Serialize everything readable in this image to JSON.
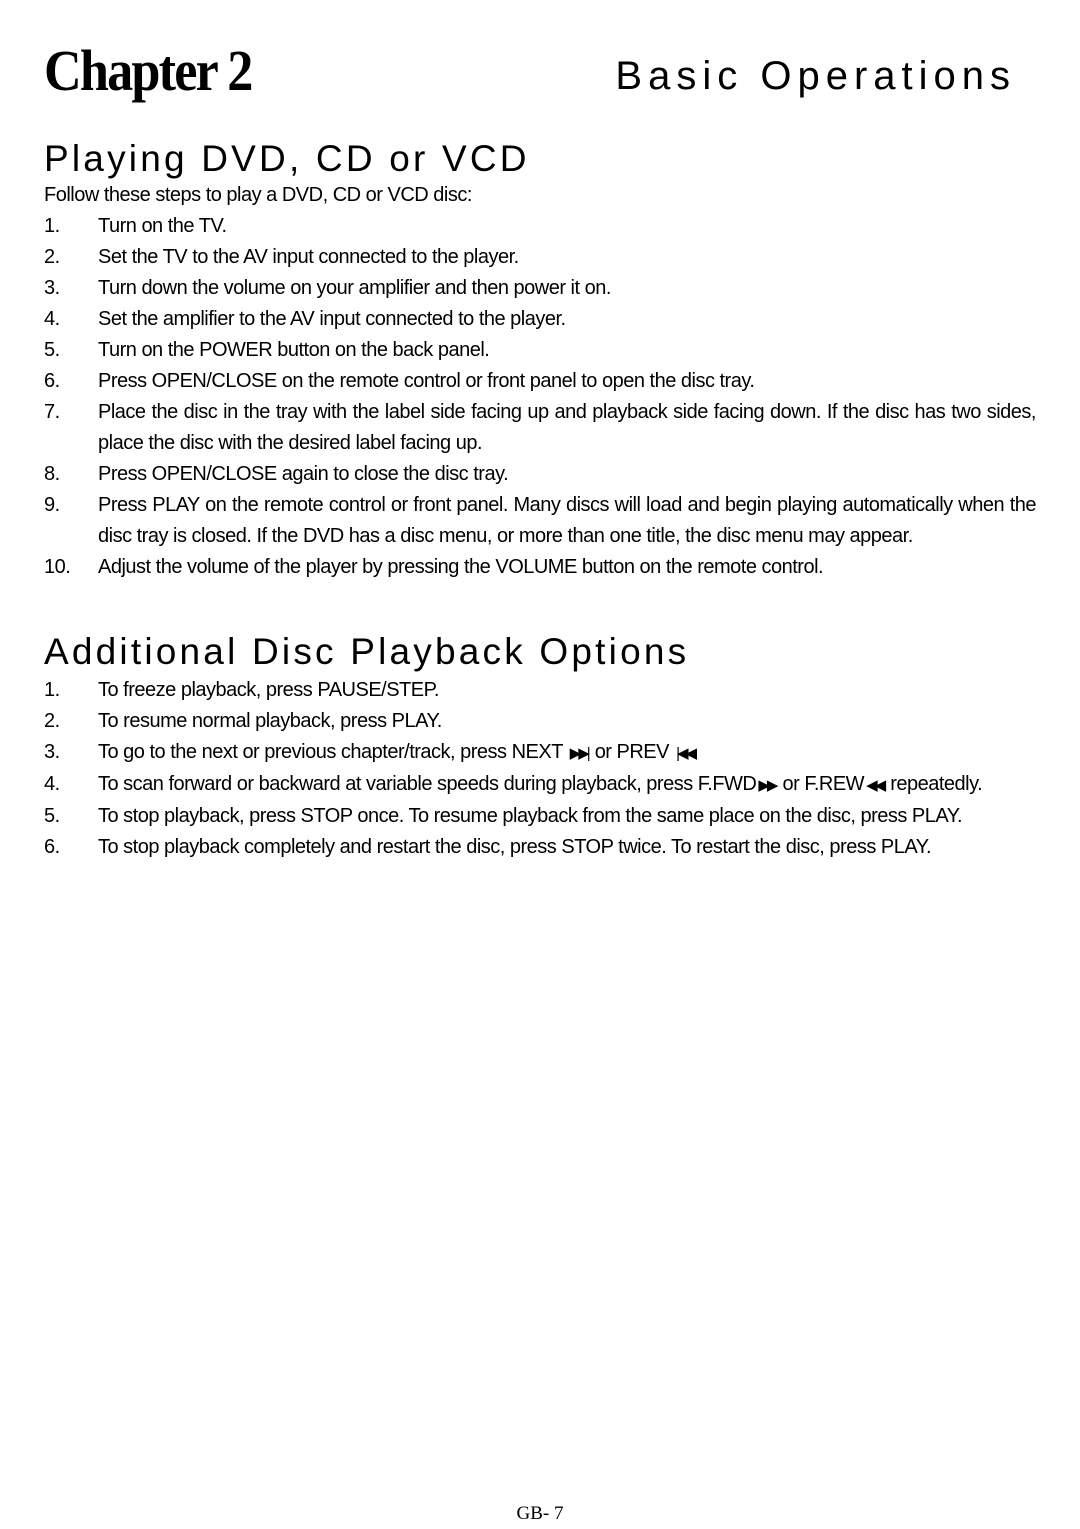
{
  "header": {
    "chapter": "Chapter 2",
    "title": "Basic Operations"
  },
  "section1": {
    "heading": "Playing DVD, CD or VCD",
    "intro": "Follow these steps to play a DVD, CD or VCD disc:",
    "steps": [
      {
        "num": "1.",
        "text": "Turn on the TV."
      },
      {
        "num": "2.",
        "text": "Set the TV to the AV input connected to the player."
      },
      {
        "num": "3.",
        "text": "Turn down the volume on your amplifier and then power it on."
      },
      {
        "num": "4.",
        "text": "Set the amplifier to the AV input connected to the player."
      },
      {
        "num": "5.",
        "text": "Turn on the POWER button on the back panel."
      },
      {
        "num": "6.",
        "text": "Press OPEN/CLOSE on the remote control or front panel to open the disc tray."
      },
      {
        "num": "7.",
        "text": "Place the disc in the tray with the label side facing up and playback side facing down. If the disc has two sides, place the disc with the desired label facing up."
      },
      {
        "num": "8.",
        "text": "Press OPEN/CLOSE again to close the disc tray."
      },
      {
        "num": "9.",
        "text": "Press PLAY on the remote control or front panel. Many discs will load and begin playing automatically when the disc tray is closed. If the DVD has a disc menu, or more than one title, the disc menu may appear."
      },
      {
        "num": "10.",
        "text": "Adjust the volume of the player by pressing the VOLUME button on the remote control."
      }
    ]
  },
  "section2": {
    "heading": "Additional Disc Playback Options",
    "steps": [
      {
        "num": "1.",
        "text": "To freeze playback, press PAUSE/STEP."
      },
      {
        "num": "2.",
        "text": "To resume normal playback, press PLAY."
      },
      {
        "num": "3.",
        "text_a": "To go to the next or previous chapter/track, press NEXT",
        "icon_a": "skip-next-icon",
        "glyph_a": "▶▶|",
        "text_b": "or PREV",
        "icon_b": "skip-previous-icon",
        "glyph_b": "|◀◀"
      },
      {
        "num": "4.",
        "text_a": "To scan forward or backward at variable speeds during playback, press F.FWD",
        "icon_a": "fast-forward-icon",
        "glyph_a": "▶▶",
        "text_b": "or F.REW",
        "icon_b": "rewind-icon",
        "glyph_b": "◀◀",
        "text_c": "repeatedly."
      },
      {
        "num": "5.",
        "text": "To stop playback, press STOP once. To resume playback from the same place on the disc, press PLAY."
      },
      {
        "num": "6.",
        "text": "To stop playback completely and restart the disc, press STOP twice. To restart the disc, press PLAY."
      }
    ]
  },
  "footer": {
    "page_number": "GB- 7"
  }
}
